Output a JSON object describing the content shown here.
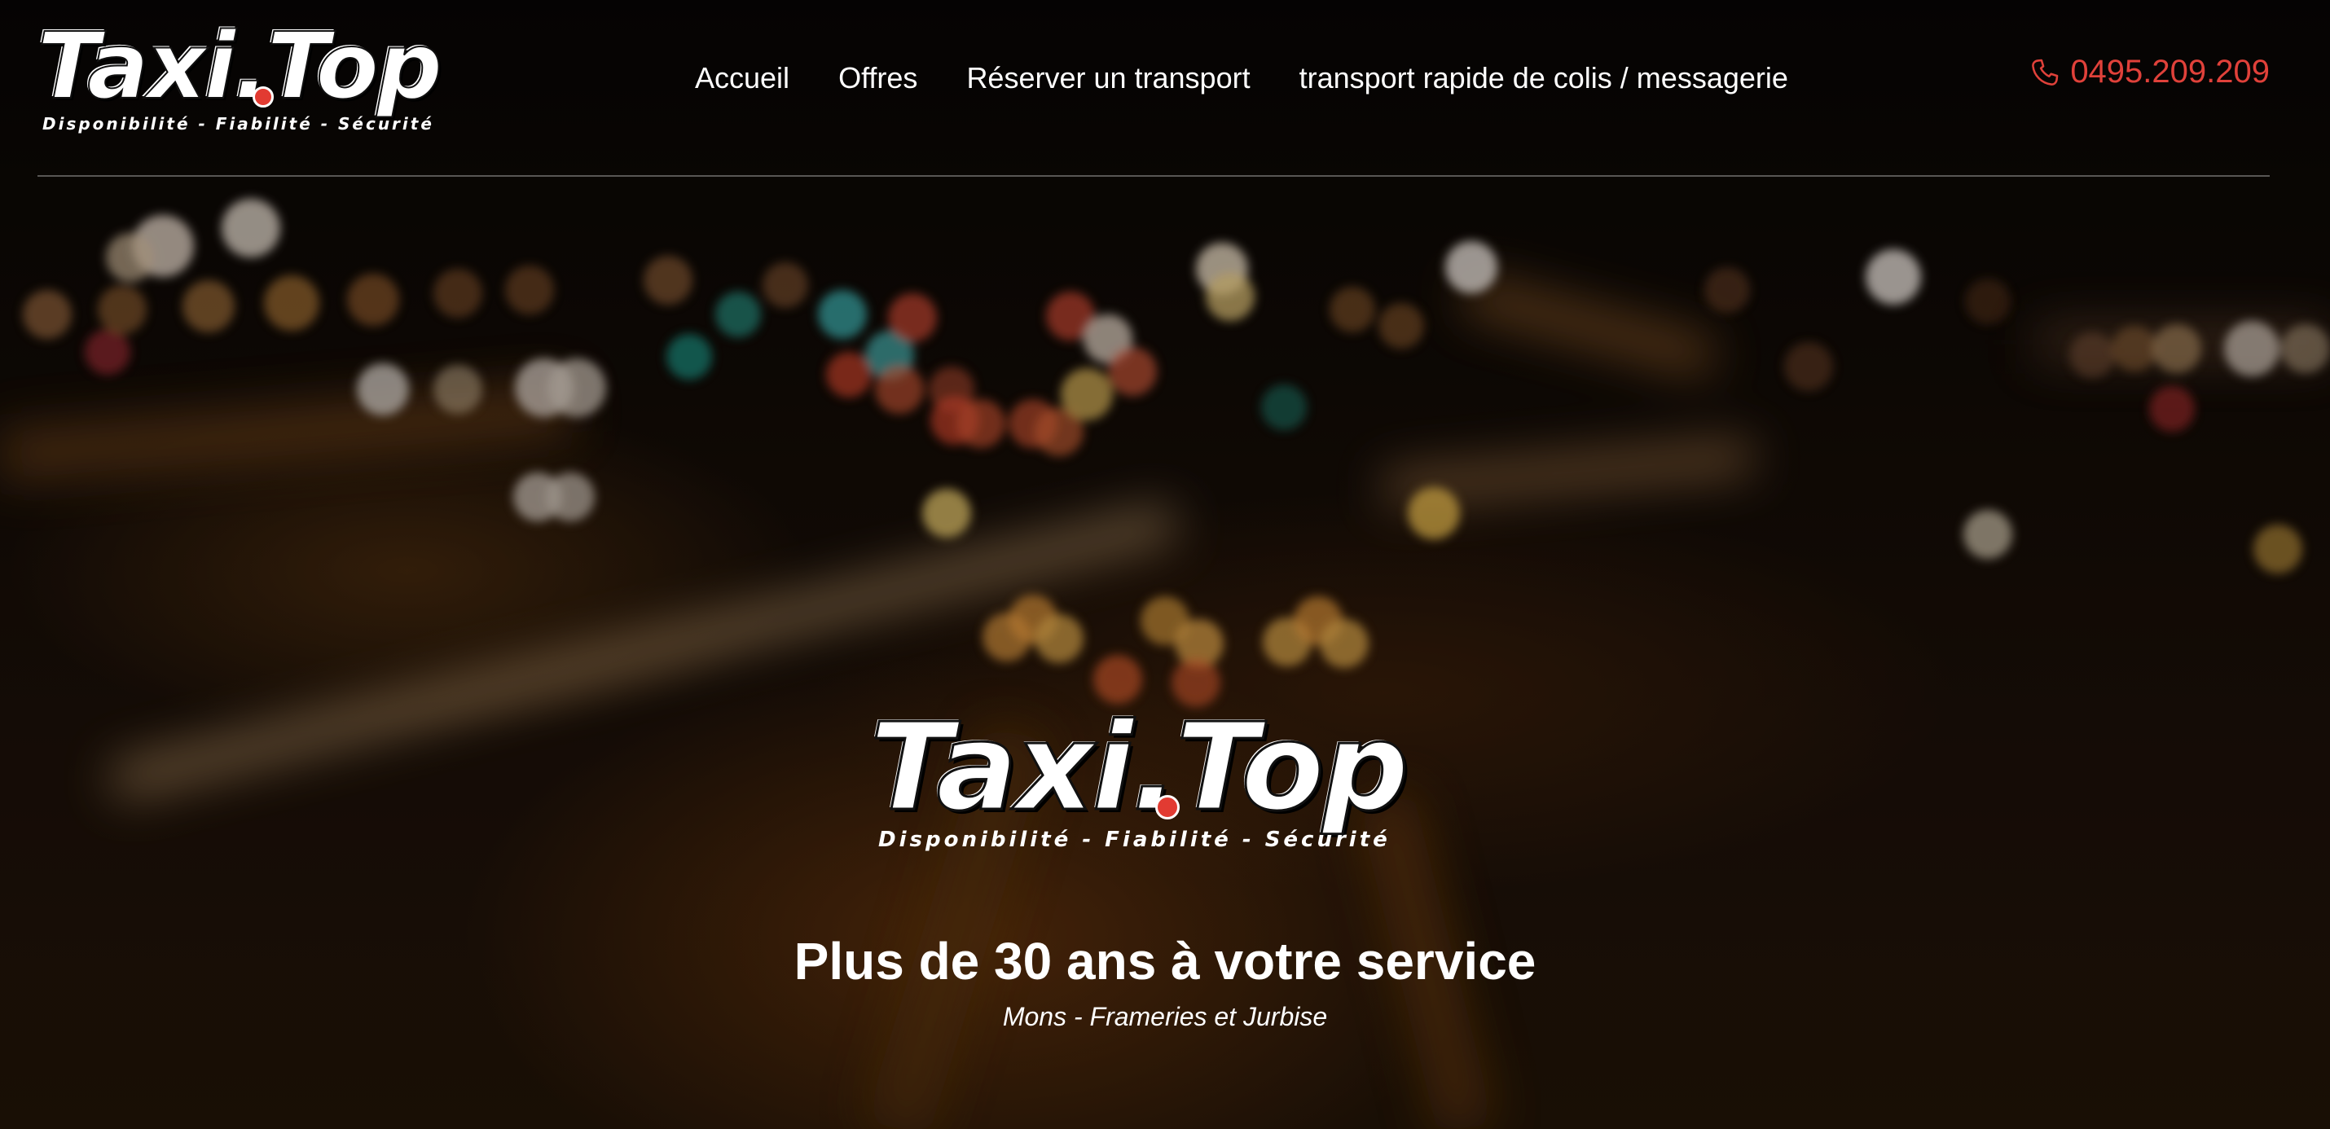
{
  "brand": {
    "name_part1": "Taxi",
    "name_part2": "Top",
    "tagline": "Disponibilité - Fiabilité - Sécurité",
    "dot_color": "#e23b32"
  },
  "nav": {
    "items": [
      {
        "label": "Accueil"
      },
      {
        "label": "Offres"
      },
      {
        "label": "Réserver un transport"
      },
      {
        "label": "transport rapide de colis / messagerie"
      }
    ]
  },
  "contact": {
    "phone": "0495.209.209",
    "phone_icon": "phone-icon",
    "accent_color": "#e0413a"
  },
  "hero": {
    "title": "Plus de 30 ans à votre service",
    "subtitle": "Mons - Frameries et Jurbise",
    "background": "blurred night traffic lights"
  }
}
